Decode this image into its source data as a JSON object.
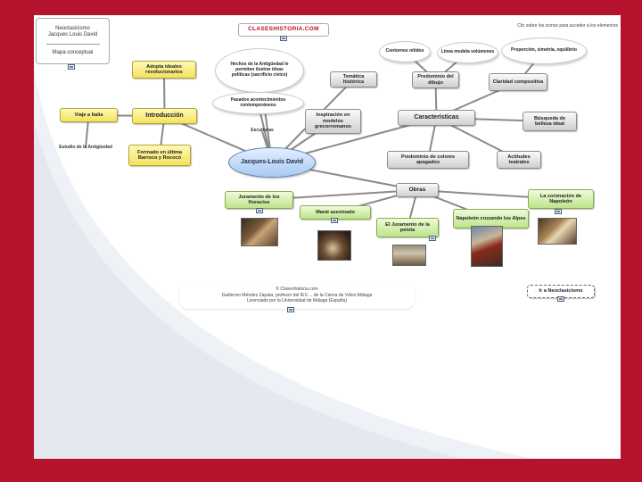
{
  "header": {
    "title_line1": "Neoclasicismo",
    "title_line2": "Jacques Louis David",
    "subtitle": "Mapa conceptual",
    "logo": "CLASESHISTORIA.COM",
    "instructions": "Clic sobre los iconos para acceder a los elementos"
  },
  "nodes": {
    "central": "Jacques-Louis David",
    "introduccion": "Introducción",
    "viaje_italia": "Viaje a Italia",
    "estudio_antiguedad": "Estudio de la Antigüedad",
    "formado": "Formado en última Barroco y Rococó",
    "adopta": "Adopta ideales revolucionarios",
    "hechos": "Hechos de la Antigüedad le permiten ilustrar ideas políticas (sacrificio cívico)",
    "pasados": "Pasados acontecimientos contemporáneos",
    "esculturas": "Esculturas",
    "tematica": "Temática histórica",
    "inspiracion": "Inspiración en modelos grecorromanos",
    "caracteristicas": "Características",
    "contornos": "Contornos nítidos",
    "linea": "Línea modela volúmenes",
    "proporcion": "Proporción, simetría, equilibrio",
    "predominio_dibujo": "Predominio del dibujo",
    "claridad": "Claridad compositiva",
    "belleza": "Búsqueda de belleza ideal",
    "colores": "Predominio de colores apagados",
    "actitudes": "Actitudes teatrales",
    "obras": "Obras",
    "juramento_horacios": "Juramento de los Horacios",
    "marat": "Marat asesinado",
    "pelota": "El Juramento de la pelota",
    "napoleon": "Napoleón cruzando los Alpes",
    "coronacion": "La coronación de Napoleón",
    "neoclasicismo_link": "Ir a Neoclasicismo"
  },
  "credits": {
    "line1": "© Claseshistoria.com",
    "line2": "Guillermo Méndez Zapata, profesor del IES ... de la Cierva de Vélez-Málaga",
    "line3": "Licenciado por la Universidad de Málaga (España)"
  },
  "colors": {
    "frame": "#b5122e",
    "yellow_node": "#f2e35c",
    "green_node": "#bde48a",
    "central_node": "#a8c8f0",
    "edge": "#8a8a8a"
  }
}
